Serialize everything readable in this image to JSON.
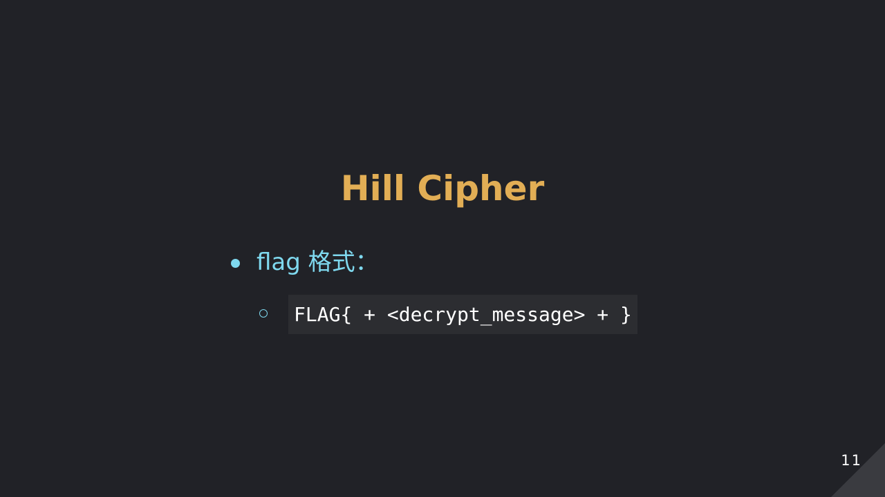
{
  "slide": {
    "title": "Hill Cipher",
    "bullets": [
      {
        "text": "flag 格式：",
        "sub_items": [
          {
            "code": "FLAG{ + <decrypt_message> + }"
          }
        ]
      }
    ],
    "page_number": "11"
  },
  "colors": {
    "background": "#212227",
    "title": "#e2ae55",
    "bullet": "#7fd9ef",
    "code_background": "#2c2d31",
    "code_text": "#ffffff",
    "corner": "#3a3b40"
  },
  "icons": {
    "bullet_level_1": "filled-circle-bullet-icon",
    "bullet_level_2": "hollow-circle-bullet-icon"
  }
}
